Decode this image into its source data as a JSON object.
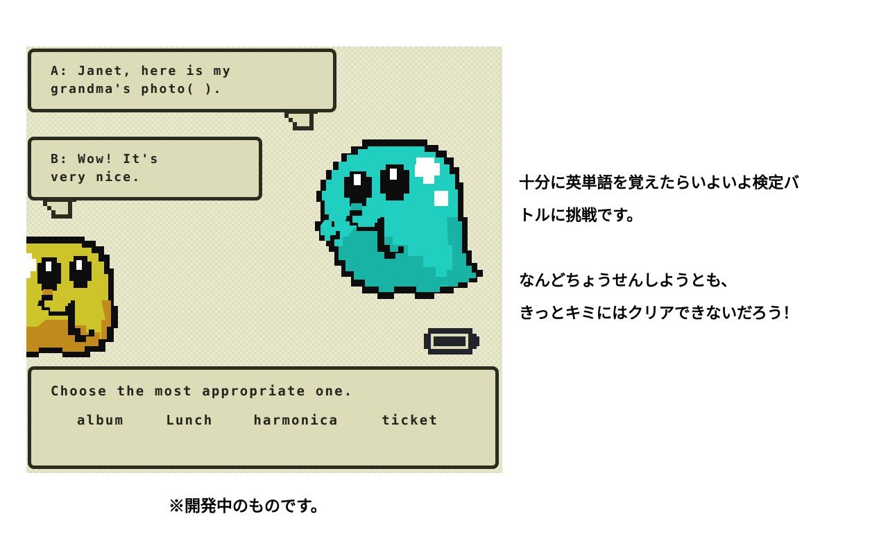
{
  "game": {
    "bubbles": [
      {
        "id": "a",
        "speaker_line_1": "A: Janet, here is my",
        "speaker_line_2": "grandma's photo( )."
      },
      {
        "id": "b",
        "speaker_line_1": "B: Wow! It's",
        "speaker_line_2": "very nice."
      }
    ],
    "answer_panel": {
      "prompt": "Choose the most appropriate one.",
      "options": [
        "album",
        "Lunch",
        "harmonica",
        "ticket"
      ]
    },
    "status": {
      "battery_icon": "battery-full-icon",
      "battery_level": "full"
    },
    "characters": [
      {
        "name": "teal-ghost",
        "color": "#21cfc0",
        "shade": "#19b3a6",
        "highlight": "#ffffff",
        "outline": "#0d0d0d"
      },
      {
        "name": "yellow-ghost",
        "color": "#cdc32a",
        "shade": "#c08a1c",
        "highlight": "#ffffff",
        "outline": "#0d0d0d"
      }
    ],
    "screen_background": "#dfdfbe",
    "panel_border": "#2b2b1e"
  },
  "sidebar_text": {
    "paragraph_1_line_1": "十分に英単語を覚えたらいよいよ検定バ",
    "paragraph_1_line_2": "トルに挑戦です。",
    "paragraph_2_line_1": "なんどちょうせんしようとも、",
    "paragraph_2_line_2": "きっとキミにはクリアできないだろう！"
  },
  "footnote": {
    "text": "※開発中のものです。"
  }
}
